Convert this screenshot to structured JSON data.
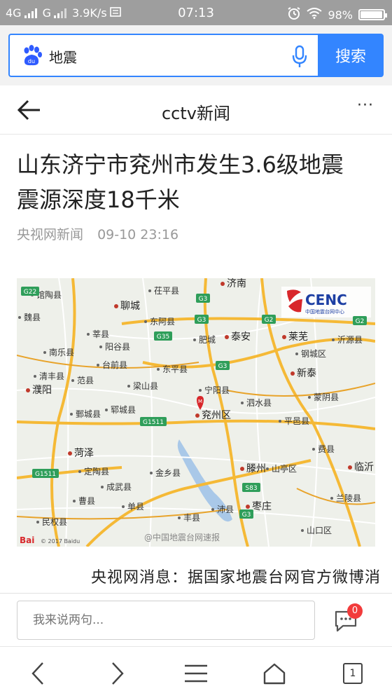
{
  "status_bar": {
    "network_1": "4G",
    "network_2": "G",
    "speed": "3.9K/s",
    "time": "07:13",
    "battery": "98%",
    "battery_level": 0.98
  },
  "search": {
    "query": "地震",
    "button_label": "搜索",
    "logo_text": "du",
    "colors": {
      "accent": "#3385ff"
    }
  },
  "nav": {
    "title": "cctv新闻",
    "back_icon": "back-arrow-icon",
    "more_label": "···"
  },
  "article": {
    "headline_line1": "山东济宁市兖州市发生3.6级地震",
    "headline_line2": "震源深度18千米",
    "source": "央视网新闻",
    "datetime": "09-10 23:16",
    "body_start": "央视网消息：据国家地震台网官方微博消"
  },
  "map": {
    "logo_text": "CENC",
    "logo_subtitle": "中国地震台网中心",
    "watermark": "@中国地震台网速报",
    "baidu_text": "Bai",
    "copyright": "© 2017 Baidu",
    "epicenter_marker": "M",
    "cities": [
      {
        "name": "馆陶县"
      },
      {
        "name": "茌平县"
      },
      {
        "name": "济南"
      },
      {
        "name": "聊城"
      },
      {
        "name": "东阿县"
      },
      {
        "name": "莘县"
      },
      {
        "name": "阳谷县"
      },
      {
        "name": "肥城"
      },
      {
        "name": "泰安"
      },
      {
        "name": "莱芜"
      },
      {
        "name": "沂源县"
      },
      {
        "name": "南乐县"
      },
      {
        "name": "台前县"
      },
      {
        "name": "东平县"
      },
      {
        "name": "钢城区"
      },
      {
        "name": "清丰县"
      },
      {
        "name": "范县"
      },
      {
        "name": "梁山县"
      },
      {
        "name": "宁阳县"
      },
      {
        "name": "新泰"
      },
      {
        "name": "濮阳"
      },
      {
        "name": "蒙阴县"
      },
      {
        "name": "郓城县"
      },
      {
        "name": "鄄城县"
      },
      {
        "name": "泗水县"
      },
      {
        "name": "兖州区"
      },
      {
        "name": "平邑县"
      },
      {
        "name": "菏泽"
      },
      {
        "name": "费县"
      },
      {
        "name": "定陶县"
      },
      {
        "name": "金乡县"
      },
      {
        "name": "滕州"
      },
      {
        "name": "山亭区"
      },
      {
        "name": "临沂"
      },
      {
        "name": "成武县"
      },
      {
        "name": "曹县"
      },
      {
        "name": "单县"
      },
      {
        "name": "沛县"
      },
      {
        "name": "枣庄"
      },
      {
        "name": "兰陵县"
      },
      {
        "name": "丰县"
      },
      {
        "name": "民权县"
      },
      {
        "name": "山口区"
      },
      {
        "name": "魏县"
      }
    ],
    "highways": [
      "G22",
      "G3",
      "G35",
      "G2",
      "G1511",
      "S83"
    ]
  },
  "comment": {
    "placeholder": "我来说两句...",
    "badge_count": "0"
  },
  "bottom_nav": {
    "tab_count": "1"
  }
}
